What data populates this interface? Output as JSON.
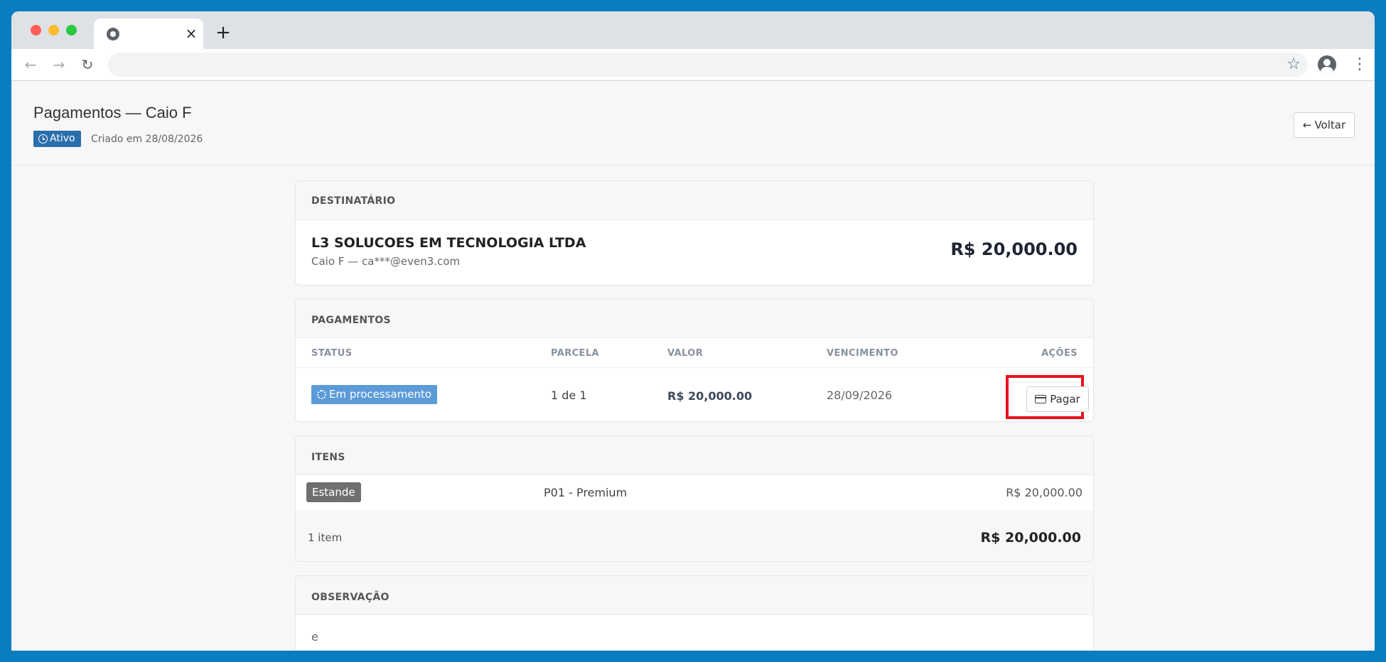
{
  "browser": {
    "tab_close": "×",
    "new_tab": "+"
  },
  "header": {
    "title": "Pagamentos — Caio F",
    "status_label": "Ativo",
    "created": "Criado em 28/08/2026",
    "back_label": "Voltar"
  },
  "recipient": {
    "section_title": "DESTINATÁRIO",
    "company": "L3 SOLUCOES EM TECNOLOGIA LTDA",
    "contact": "Caio F — ca***@even3.com",
    "total": "R$ 20,000.00"
  },
  "payments": {
    "section_title": "PAGAMENTOS",
    "columns": [
      "STATUS",
      "PARCELA",
      "VALOR",
      "VENCIMENTO",
      "AÇÕES"
    ],
    "rows": [
      {
        "status": "Em processamento",
        "parcela": "1 de 1",
        "valor": "R$ 20,000.00",
        "vencimento": "28/09/2026",
        "action": "Pagar"
      }
    ]
  },
  "items": {
    "section_title": "ITENS",
    "rows": [
      {
        "category": "Estande",
        "name": "P01 - Premium",
        "price": "R$ 20,000.00"
      }
    ],
    "count": "1 item",
    "total": "R$ 20,000.00"
  },
  "observation": {
    "section_title": "OBSERVAÇÃO",
    "text": "e"
  },
  "colors": {
    "active_badge": "#2a6fad",
    "processing_badge": "#5b9bd8",
    "category_badge": "#6f6f6f",
    "highlight": "#e8141c",
    "background": "#0a7cc0"
  }
}
